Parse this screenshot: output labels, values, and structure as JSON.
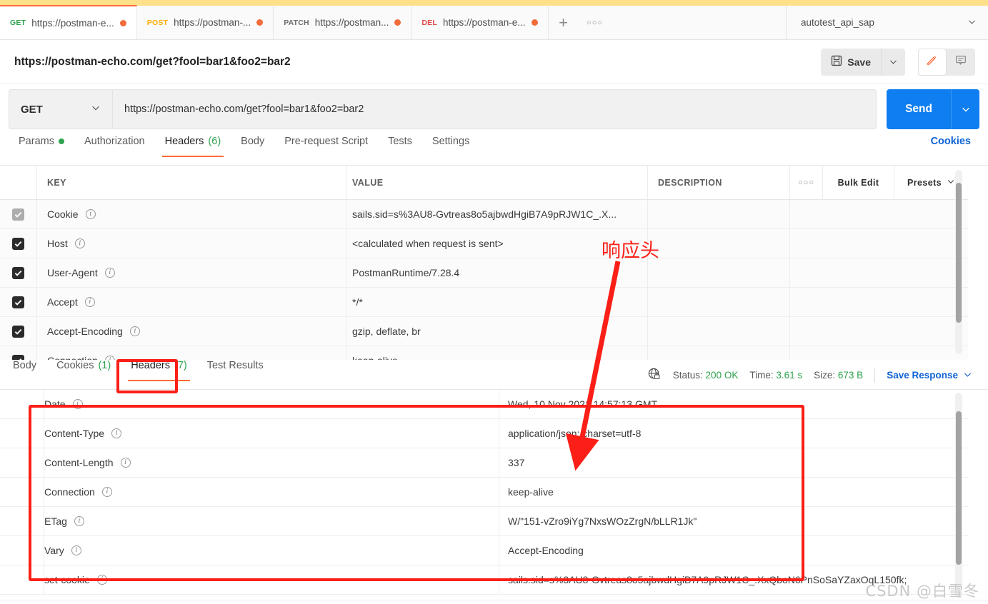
{
  "window": {
    "top_strip_color": "#ffe08a",
    "accent_orange": "#ff6c37",
    "accent_blue": "#0f7ef0",
    "green": "#2fa24f",
    "annotation_red": "#fb1f17"
  },
  "tabs": [
    {
      "method": "GET",
      "label": "https://postman-e...",
      "unsaved": true,
      "active": true
    },
    {
      "method": "POST",
      "label": "https://postman-...",
      "unsaved": true,
      "active": false
    },
    {
      "method": "PATCH",
      "label": "https://postman...",
      "unsaved": true,
      "active": false
    },
    {
      "method": "DEL",
      "label": "https://postman-e...",
      "unsaved": true,
      "active": false
    }
  ],
  "tabbar": {
    "new_tab": "+",
    "more": "○○○",
    "environment": "autotest_api_sap"
  },
  "request": {
    "title": "https://postman-echo.com/get?fool=bar1&foo2=bar2",
    "save_label": "Save",
    "method": "GET",
    "url": "https://postman-echo.com/get?fool=bar1&foo2=bar2",
    "send_label": "Send"
  },
  "request_tabs": [
    {
      "label": "Params",
      "count": "",
      "dot": true,
      "active": false
    },
    {
      "label": "Authorization",
      "count": "",
      "dot": false,
      "active": false
    },
    {
      "label": "Headers",
      "count": "(6)",
      "dot": false,
      "active": true
    },
    {
      "label": "Body",
      "count": "",
      "dot": false,
      "active": false
    },
    {
      "label": "Pre-request Script",
      "count": "",
      "dot": false,
      "active": false
    },
    {
      "label": "Tests",
      "count": "",
      "dot": false,
      "active": false
    },
    {
      "label": "Settings",
      "count": "",
      "dot": false,
      "active": false
    }
  ],
  "cookies_link": "Cookies",
  "request_headers": {
    "columns": {
      "key": "KEY",
      "value": "VALUE",
      "description": "DESCRIPTION"
    },
    "more_dots": "○○○",
    "bulk_edit": "Bulk Edit",
    "presets": "Presets",
    "rows": [
      {
        "checked": "dim",
        "key": "Cookie",
        "value": "sails.sid=s%3AU8-Gvtreas8o5ajbwdHgiB7A9pRJW1C_.X...",
        "description": ""
      },
      {
        "checked": "on",
        "key": "Host",
        "value": "<calculated when request is sent>",
        "description": ""
      },
      {
        "checked": "on",
        "key": "User-Agent",
        "value": "PostmanRuntime/7.28.4",
        "description": ""
      },
      {
        "checked": "on",
        "key": "Accept",
        "value": "*/*",
        "description": ""
      },
      {
        "checked": "on",
        "key": "Accept-Encoding",
        "value": "gzip, deflate, br",
        "description": ""
      },
      {
        "checked": "on",
        "key": "Connection",
        "value": "keep-alive",
        "description": ""
      }
    ]
  },
  "response_tabs": [
    {
      "label": "Body",
      "count": "",
      "active": false
    },
    {
      "label": "Cookies",
      "count": "(1)",
      "active": false
    },
    {
      "label": "Headers",
      "count": "(7)",
      "active": true
    },
    {
      "label": "Test Results",
      "count": "",
      "active": false
    }
  ],
  "response_meta": {
    "status_label": "Status:",
    "status_value": "200 OK",
    "time_label": "Time:",
    "time_value": "3.61 s",
    "size_label": "Size:",
    "size_value": "673 B",
    "save_response": "Save Response"
  },
  "response_headers": [
    {
      "key": "Date",
      "value": "Wed, 10 Nov 2021 14:57:13 GMT"
    },
    {
      "key": "Content-Type",
      "value": "application/json; charset=utf-8"
    },
    {
      "key": "Content-Length",
      "value": "337"
    },
    {
      "key": "Connection",
      "value": "keep-alive"
    },
    {
      "key": "ETag",
      "value": "W/\"151-vZro9iYg7NxsWOzZrgN/bLLR1Jk\""
    },
    {
      "key": "Vary",
      "value": "Accept-Encoding"
    },
    {
      "key": "set-cookie",
      "value": "sails.sid=s%3AU8-Gvtreas8o5ajbwdHgiB7A9pRJW1C_.XxQboN6PnSoSaYZaxOqL150fk;"
    }
  ],
  "annotations": {
    "label": "响应头"
  },
  "watermark": "CSDN @白雪冬"
}
